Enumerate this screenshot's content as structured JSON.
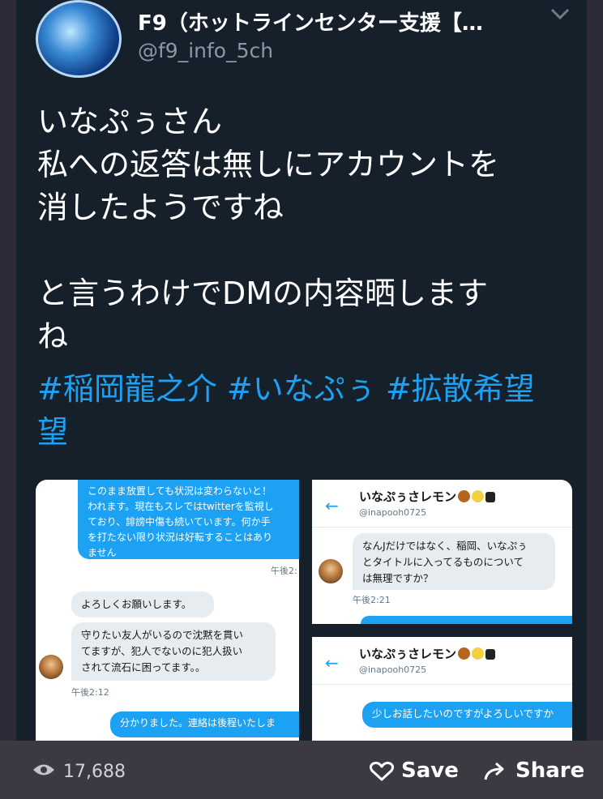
{
  "tweet": {
    "display_name": "F9（ホットラインセンター支援【…",
    "handle": "@f9_info_5ch",
    "lines": [
      "いなぷぅさん",
      "私への返答は無しにアカウントを",
      "消したようですね",
      "",
      "と言うわけでDMの内容晒します",
      "ね"
    ],
    "hashtags": "#稲岡龍之介 #いなぷぅ #拡散希望",
    "hashtags_line2": "望"
  },
  "media": {
    "shot1": {
      "blue_top": [
        "このまま放置しても状況は変わらないと！",
        "われます。現在もスレではtwitterを監視し",
        "ており、誹謗中傷も続いています。何か手",
        "を打たない限り状況は好転することはあり",
        "ません"
      ],
      "time1": "午後2:",
      "gray1": "よろしくお願いします。",
      "gray2": [
        "守りたい友人がいるので沈黙を貫い",
        "てますが、犯人でないのに犯人扱い",
        "されて流石に困ってます。。"
      ],
      "time2": "午後2:12",
      "blue_bottom": "分かりました。連絡は後程いたしま"
    },
    "shot2": {
      "name": "いなぷぅさレモン",
      "handle": "@inapooh0725",
      "gray": [
        "なんJだけではなく、稲岡、いなぷぅ",
        "とタイトルに入ってるものについて",
        "は無理ですか？"
      ],
      "time": "午後2:21"
    },
    "shot3": {
      "name": "いなぷぅさレモン",
      "handle": "@inapooh0725",
      "blue": "少しお話したいのですがよろしいですか"
    }
  },
  "footer": {
    "views": "17,688",
    "save_label": "Save",
    "share_label": "Share"
  },
  "colors": {
    "link": "#1da1f2",
    "tweet_bg": "#15202b",
    "bar_bg": "#3b3a43"
  }
}
